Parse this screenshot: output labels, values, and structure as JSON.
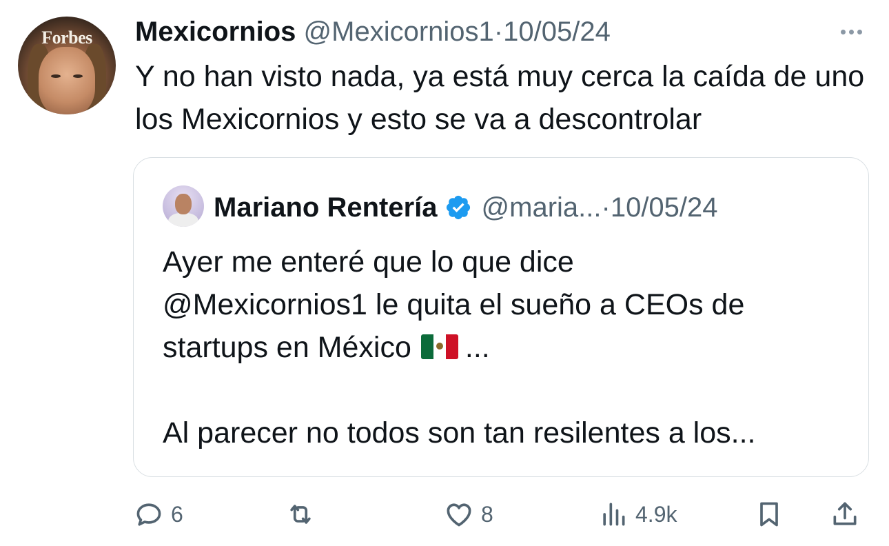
{
  "tweet": {
    "author_name": "Mexicornios",
    "handle": "@Mexicornios1",
    "separator": "·",
    "date": "10/05/24",
    "avatar_label": "Forbes",
    "text": "Y no han visto nada, ya está muy cerca la caída de uno los Mexicornios y esto se va a descontrolar"
  },
  "quote": {
    "author_name": "Mariano Rentería",
    "handle": "@maria...",
    "separator": "·",
    "date": "10/05/24",
    "line1": "Ayer me enteré que lo que dice",
    "line2": "@Mexicornios1 le quita el sueño a CEOs de",
    "line3_before_flag": "startups en México",
    "line3_after_flag": "...",
    "line5": "Al parecer no todos son tan resilentes a los..."
  },
  "actions": {
    "replies": "6",
    "likes": "8",
    "views": "4.9k"
  },
  "icons": {
    "more": "more-horizontal-icon",
    "verified": "verified-badge-icon",
    "reply": "reply-icon",
    "retweet": "retweet-icon",
    "like": "heart-icon",
    "views": "views-icon",
    "bookmark": "bookmark-icon",
    "share": "share-icon"
  },
  "colors": {
    "text": "#0f1419",
    "secondary": "#536471",
    "verified": "#1d9bf0",
    "border": "#d9dfe3"
  }
}
